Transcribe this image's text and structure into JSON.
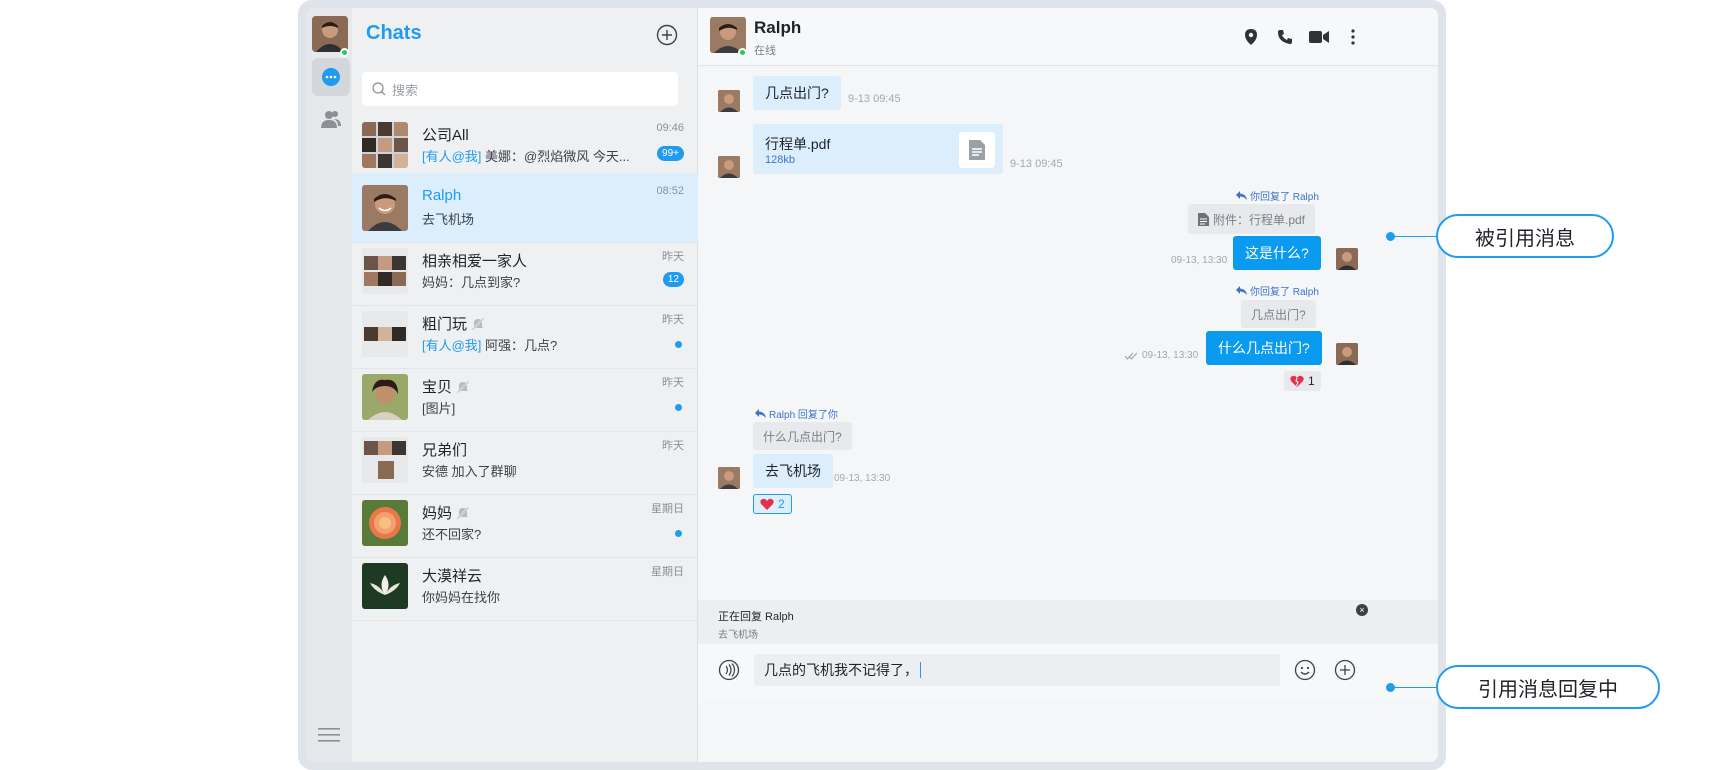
{
  "sidebar": {
    "list_title": "Chats",
    "search_placeholder": "搜索",
    "chats": [
      {
        "name": "公司All",
        "mention": "[有人@我]",
        "preview": "美娜：@烈焰微风 今天...",
        "time": "09:46",
        "badge": "99+"
      },
      {
        "name": "Ralph",
        "preview": "去飞机场",
        "time": "08:52"
      },
      {
        "name": "相亲相爱一家人",
        "preview": "妈妈：几点到家?",
        "time": "昨天",
        "badge": "12"
      },
      {
        "name": "粗门玩",
        "mention": "[有人@我]",
        "preview": "阿强：几点?",
        "time": "昨天",
        "muted": true
      },
      {
        "name": "宝贝",
        "preview": "[图片]",
        "time": "昨天",
        "muted": true
      },
      {
        "name": "兄弟们",
        "preview": "安德 加入了群聊",
        "time": "昨天"
      },
      {
        "name": "妈妈",
        "preview": "还不回家?",
        "time": "星期日",
        "muted": true
      },
      {
        "name": "大漠祥云",
        "preview": "你妈妈在找你",
        "time": "星期日"
      }
    ]
  },
  "conversation": {
    "name": "Ralph",
    "status": "在线",
    "msg1": {
      "text": "几点出门?",
      "time": "9-13 09:45"
    },
    "file": {
      "name": "行程单.pdf",
      "size": "128kb",
      "time": "9-13 09:45"
    },
    "reply1": {
      "tag": "你回复了 Ralph",
      "quote": "附件：行程单.pdf",
      "text": "这是什么?",
      "time": "09-13, 13:30"
    },
    "reply2": {
      "tag": "你回复了 Ralph",
      "quote": "几点出门?",
      "text": "什么几点出门?",
      "time": "09-13, 13:30",
      "reaction_count": "1"
    },
    "reply3": {
      "tag": "Ralph 回复了你",
      "quote": "什么几点出门?",
      "text": "去飞机场",
      "time": "09-13, 13:30",
      "reaction_count": "2"
    }
  },
  "reply_bar": {
    "title": "正在回复 Ralph",
    "quote": "去飞机场"
  },
  "composer": {
    "text": "几点的飞机我不记得了，"
  },
  "callouts": {
    "quoted": "被引用消息",
    "replying": "引用消息回复中"
  },
  "colors": {
    "accent": "#1f9bf0",
    "outgoing_bubble": "#0a9af0",
    "incoming_bubble": "#dceefb"
  }
}
